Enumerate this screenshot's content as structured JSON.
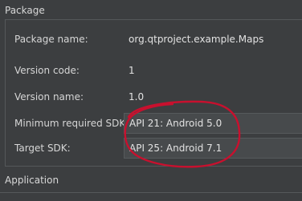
{
  "sections": {
    "package": "Package",
    "application": "Application"
  },
  "fields": {
    "package_name": {
      "label": "Package name:",
      "value": "org.qtproject.example.Maps"
    },
    "version_code": {
      "label": "Version code:",
      "value": "1"
    },
    "version_name": {
      "label": "Version name:",
      "value": "1.0"
    },
    "min_sdk": {
      "label": "Minimum required SDK:",
      "value": "API 21: Android 5.0"
    },
    "target_sdk": {
      "label": "Target SDK:",
      "value": "API 25: Android 7.1"
    }
  },
  "colors": {
    "annotation": "#c8102e"
  }
}
